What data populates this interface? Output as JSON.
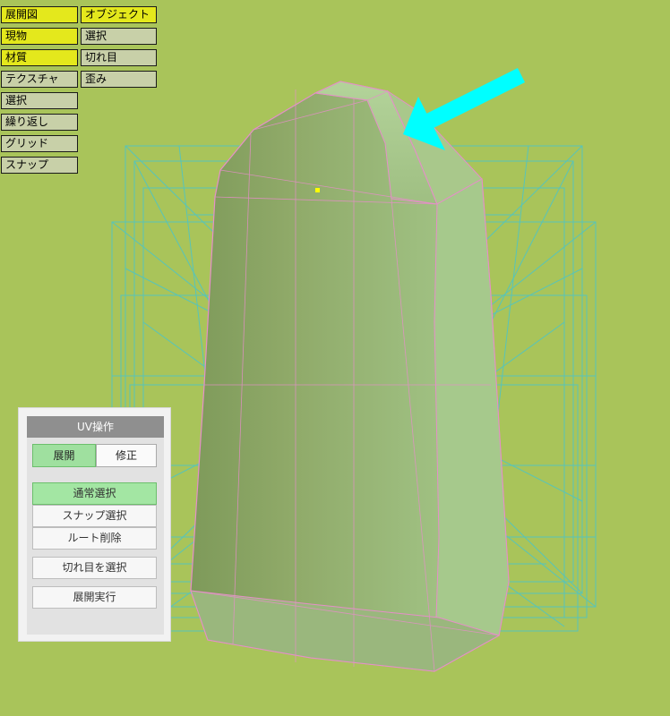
{
  "toolbar": {
    "left_column": [
      {
        "label": "展開図",
        "active": true
      },
      {
        "label": "現物",
        "active": true
      },
      {
        "label": "材質",
        "active": true
      },
      {
        "label": "テクスチャ",
        "active": false
      },
      {
        "label": "選択",
        "active": false
      },
      {
        "label": "繰り返し",
        "active": false
      },
      {
        "label": "グリッド",
        "active": false
      },
      {
        "label": "スナップ",
        "active": false
      }
    ],
    "right_column": [
      {
        "label": "オブジェクト",
        "active": true
      },
      {
        "label": "選択",
        "active": false
      },
      {
        "label": "切れ目",
        "active": false
      },
      {
        "label": "歪み",
        "active": false
      }
    ]
  },
  "uv_panel": {
    "title": "UV操作",
    "tabs": [
      {
        "label": "展開",
        "active": true
      },
      {
        "label": "修正",
        "active": false
      }
    ],
    "buttons": [
      {
        "label": "通常選択",
        "active": true
      },
      {
        "label": "スナップ選択",
        "active": false
      },
      {
        "label": "ルート削除",
        "active": false
      },
      {
        "label": "切れ目を選択",
        "active": false
      },
      {
        "label": "展開実行",
        "active": false
      }
    ]
  },
  "colors": {
    "background": "#a9c45a",
    "button_active": "#e4e81c",
    "button_inactive": "#c8d0a8",
    "arrow": "#00ffff",
    "wireframe": "#4fc4c4",
    "seam": "#e58fc8",
    "model_fill": "#8cb070",
    "selected_vertex": "#ffff00"
  }
}
